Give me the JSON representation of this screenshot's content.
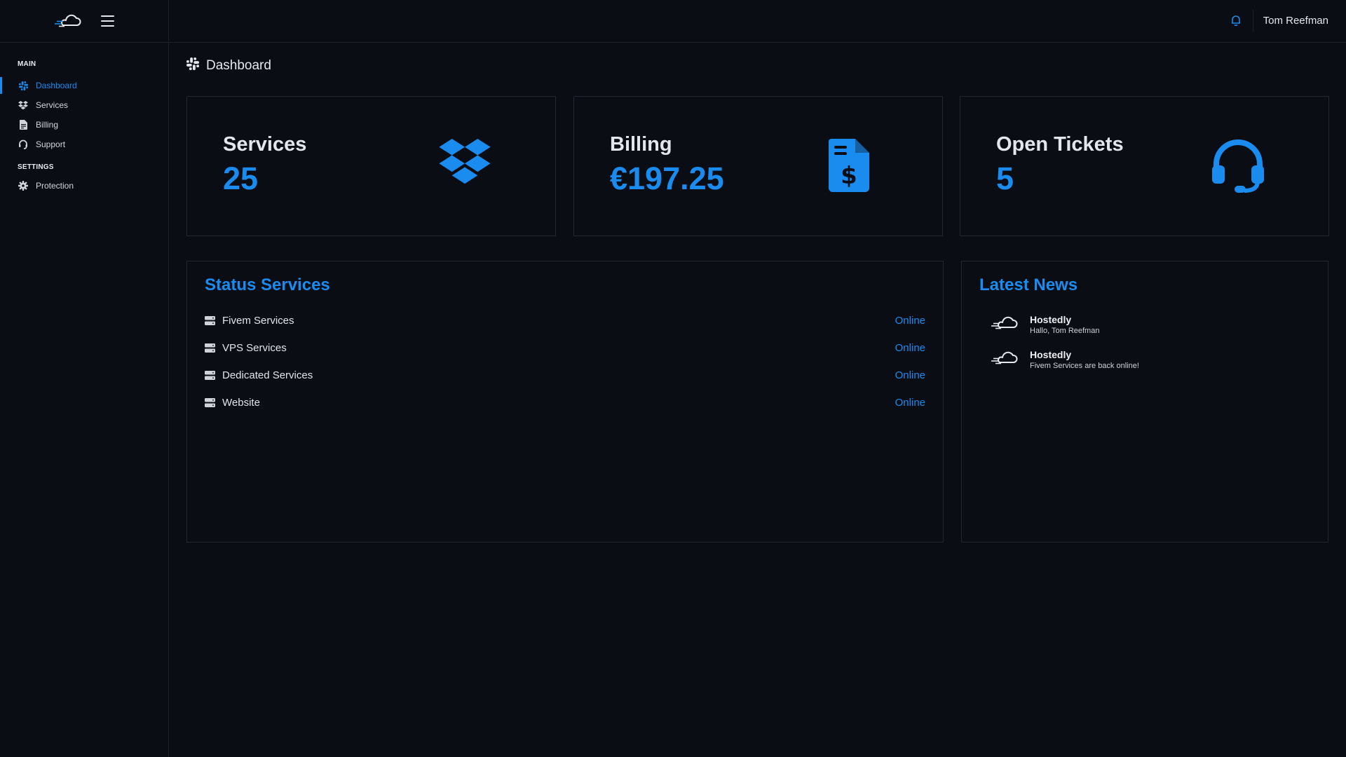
{
  "sidebar": {
    "sections": {
      "main": "MAIN",
      "settings": "SETTINGS"
    },
    "main_items": [
      {
        "label": "Dashboard",
        "icon": "slack-icon",
        "active": true
      },
      {
        "label": "Services",
        "icon": "dropbox-icon"
      },
      {
        "label": "Billing",
        "icon": "invoice-icon"
      },
      {
        "label": "Support",
        "icon": "headset-icon"
      }
    ],
    "settings_items": [
      {
        "label": "Protection",
        "icon": "gear-icon"
      }
    ]
  },
  "topbar": {
    "user_name": "Tom Reefman",
    "notification_icon": "bell-icon"
  },
  "page": {
    "title": "Dashboard",
    "title_icon": "slack-icon"
  },
  "stats": [
    {
      "label": "Services",
      "value": "25",
      "icon": "dropbox-icon"
    },
    {
      "label": "Billing",
      "value": "€197.25",
      "icon": "invoice-dollar-icon"
    },
    {
      "label": "Open Tickets",
      "value": "5",
      "icon": "headset-icon"
    }
  ],
  "status_services": {
    "title": "Status Services",
    "items": [
      {
        "name": "Fivem Services",
        "status": "Online"
      },
      {
        "name": "VPS Services",
        "status": "Online"
      },
      {
        "name": "Dedicated Services",
        "status": "Online"
      },
      {
        "name": "Website",
        "status": "Online"
      }
    ]
  },
  "latest_news": {
    "title": "Latest News",
    "items": [
      {
        "author": "Hostedly",
        "message": "Hallo, Tom Reefman"
      },
      {
        "author": "Hostedly",
        "message": "Fivem Services are back online!"
      }
    ]
  },
  "colors": {
    "accent": "#1a8cf0",
    "background": "#0b0d15",
    "border": "#232733"
  }
}
